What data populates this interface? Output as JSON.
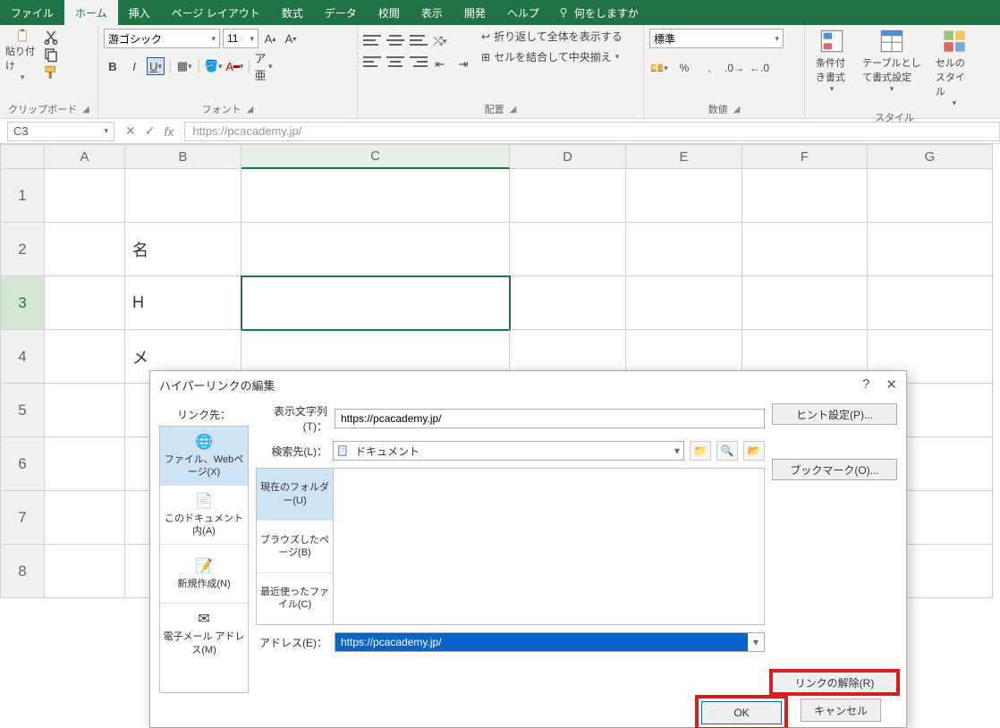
{
  "menubar": {
    "items": [
      "ファイル",
      "ホーム",
      "挿入",
      "ページ レイアウト",
      "数式",
      "データ",
      "校閲",
      "表示",
      "開発",
      "ヘルプ"
    ],
    "activeIndex": 1,
    "searchPlaceholder": "何をしますか"
  },
  "ribbon": {
    "clipboard": {
      "paste": "貼り付け",
      "label": "クリップボード"
    },
    "font": {
      "family": "游ゴシック",
      "size": "11",
      "bold": "B",
      "italic": "I",
      "underline": "U",
      "label": "フォント",
      "increase": "A",
      "decrease": "A"
    },
    "alignment": {
      "wrap": "折り返して全体を表示する",
      "merge": "セルを結合して中央揃え",
      "label": "配置"
    },
    "number": {
      "format": "標準",
      "label": "数値"
    },
    "styles": {
      "conditional": "条件付き書式",
      "tableformat": "テーブルとして書式設定",
      "cellstyles": "セルのスタイル",
      "label": "スタイル"
    }
  },
  "formulaBar": {
    "nameBox": "C3",
    "formula": "https://pcacademy.jp/"
  },
  "sheet": {
    "columns": [
      "A",
      "B",
      "C",
      "D",
      "E",
      "F",
      "G"
    ],
    "rows": [
      "1",
      "2",
      "3",
      "4",
      "5",
      "6",
      "7",
      "8"
    ],
    "cells": {
      "b2": "名",
      "b3": "H",
      "b4": "メ"
    }
  },
  "dialog": {
    "title": "ハイパーリンクの編集",
    "help": "?",
    "close": "✕",
    "linkToLabel": "リンク先：",
    "linkTo": [
      {
        "label": "ファイル、Webページ(X)",
        "icon": "🌐"
      },
      {
        "label": "このドキュメント内(A)",
        "icon": "📄"
      },
      {
        "label": "新規作成(N)",
        "icon": "📝"
      },
      {
        "label": "電子メール アドレス(M)",
        "icon": "✉"
      }
    ],
    "displayLabel": "表示文字列(T)：",
    "displayValue": "https://pcacademy.jp/",
    "hintBtn": "ヒント設定(P)...",
    "lookInLabel": "検索先(L)：",
    "lookInValue": "ドキュメント",
    "browseTabs": [
      "現在のフォルダー(U)",
      "ブラウズしたページ(B)",
      "最近使ったファイル(C)"
    ],
    "bookmarkBtn": "ブックマーク(O)...",
    "addressLabel": "アドレス(E)：",
    "addressValue": "https://pcacademy.jp/",
    "removeLinkBtn": "リンクの解除(R)",
    "ok": "OK",
    "cancel": "キャンセル"
  }
}
